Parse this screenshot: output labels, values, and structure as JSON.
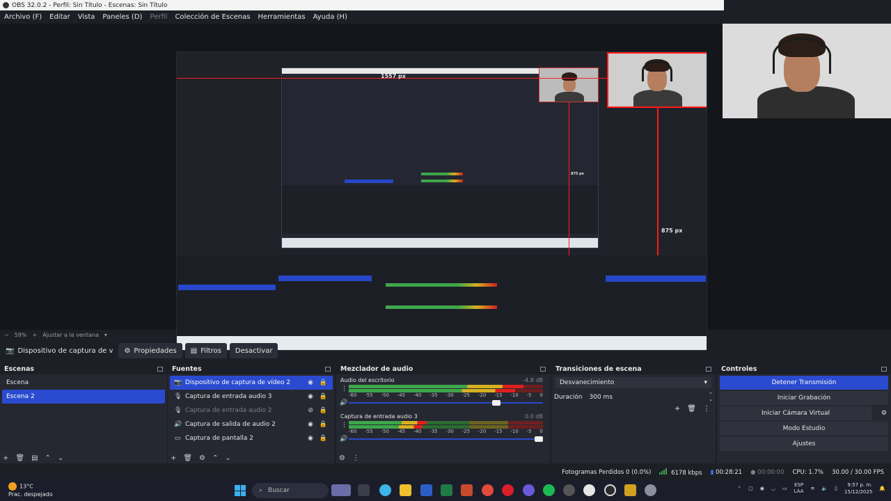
{
  "window": {
    "title": "OBS 32.0.2 - Perfil: Sin Título - Escenas: Sin Título"
  },
  "menu": [
    {
      "label": "Archivo (F)",
      "enabled": true
    },
    {
      "label": "Editar",
      "enabled": true
    },
    {
      "label": "Vista",
      "enabled": true
    },
    {
      "label": "Paneles (D)",
      "enabled": true
    },
    {
      "label": "Perfil",
      "enabled": false
    },
    {
      "label": "Colección de Escenas",
      "enabled": true
    },
    {
      "label": "Herramientas",
      "enabled": true
    },
    {
      "label": "Ayuda (H)",
      "enabled": true
    }
  ],
  "preview": {
    "measure_top": "1557 px",
    "measure_right": "875 px",
    "measure_inner": "875 px"
  },
  "zoom": {
    "minus": "−",
    "value": "59%",
    "plus": "+",
    "fit_label": "Ajustar a la ventana"
  },
  "source_toolbar": {
    "selected_source": "Dispositivo de captura de v",
    "properties": "Propiedades",
    "filters": "Filtros",
    "deactivate": "Desactivar"
  },
  "scenes": {
    "title": "Escenas",
    "items": [
      {
        "label": "Escena",
        "selected": false
      },
      {
        "label": "Escena 2",
        "selected": true
      }
    ]
  },
  "sources": {
    "title": "Fuentes",
    "items": [
      {
        "label": "Dispositivo de captura de vídeo 2",
        "icon": "camera-icon",
        "glyph": "📷",
        "selected": true,
        "visible": true
      },
      {
        "label": "Captura de entrada audio 3",
        "icon": "microphone-icon",
        "glyph": "🎙",
        "selected": false,
        "visible": true
      },
      {
        "label": "Captura de entrada audio 2",
        "icon": "microphone-icon",
        "glyph": "🎙",
        "selected": false,
        "visible": false
      },
      {
        "label": "Captura de salida de audio 2",
        "icon": "speaker-icon",
        "glyph": "🔊",
        "selected": false,
        "visible": true
      },
      {
        "label": "Captura de pantalla 2",
        "icon": "monitor-icon",
        "glyph": "▭",
        "selected": false,
        "visible": true
      }
    ]
  },
  "mixer": {
    "title": "Mezclador de audio",
    "scale": [
      "-60",
      "-55",
      "-50",
      "-45",
      "-40",
      "-35",
      "-30",
      "-25",
      "-20",
      "-15",
      "-10",
      "-5",
      "0"
    ],
    "channels": [
      {
        "name": "Audio del escritorio",
        "db": "-4.8 dB",
        "level": 0.9,
        "volume": 0.78
      },
      {
        "name": "Captura de entrada audio 3",
        "db": "0.0 dB",
        "level": 0.4,
        "volume": 1.0
      }
    ]
  },
  "transitions": {
    "title": "Transiciones de escena",
    "selected": "Desvanecimiento",
    "duration_label": "Duración",
    "duration_value": "300 ms"
  },
  "controls": {
    "title": "Controles",
    "stop_stream": "Detener Transmisión",
    "start_recording": "Iniciar Grabación",
    "start_virtual_cam": "Iniciar Cámara Virtual",
    "studio_mode": "Modo Estudio",
    "settings": "Ajustes"
  },
  "status": {
    "dropped_frames": "Fotogramas Perdidos 0 (0.0%)",
    "bitrate": "6178 kbps",
    "stream_time": "00:28:21",
    "record_time": "00:00:00",
    "cpu": "CPU: 1.7%",
    "fps": "30.00 / 30.00 FPS"
  },
  "taskbar": {
    "temperature": "13°C",
    "weather": "Prac. despejado",
    "search_placeholder": "Buscar",
    "lang_top": "ESP",
    "lang_bottom": "LAA",
    "time": "9:57 p. m.",
    "date": "15/12/2025"
  },
  "colors": {
    "accent": "#2a4bd0",
    "measure_line": "#ff1a1a",
    "meter_green": "#3ea64a"
  }
}
